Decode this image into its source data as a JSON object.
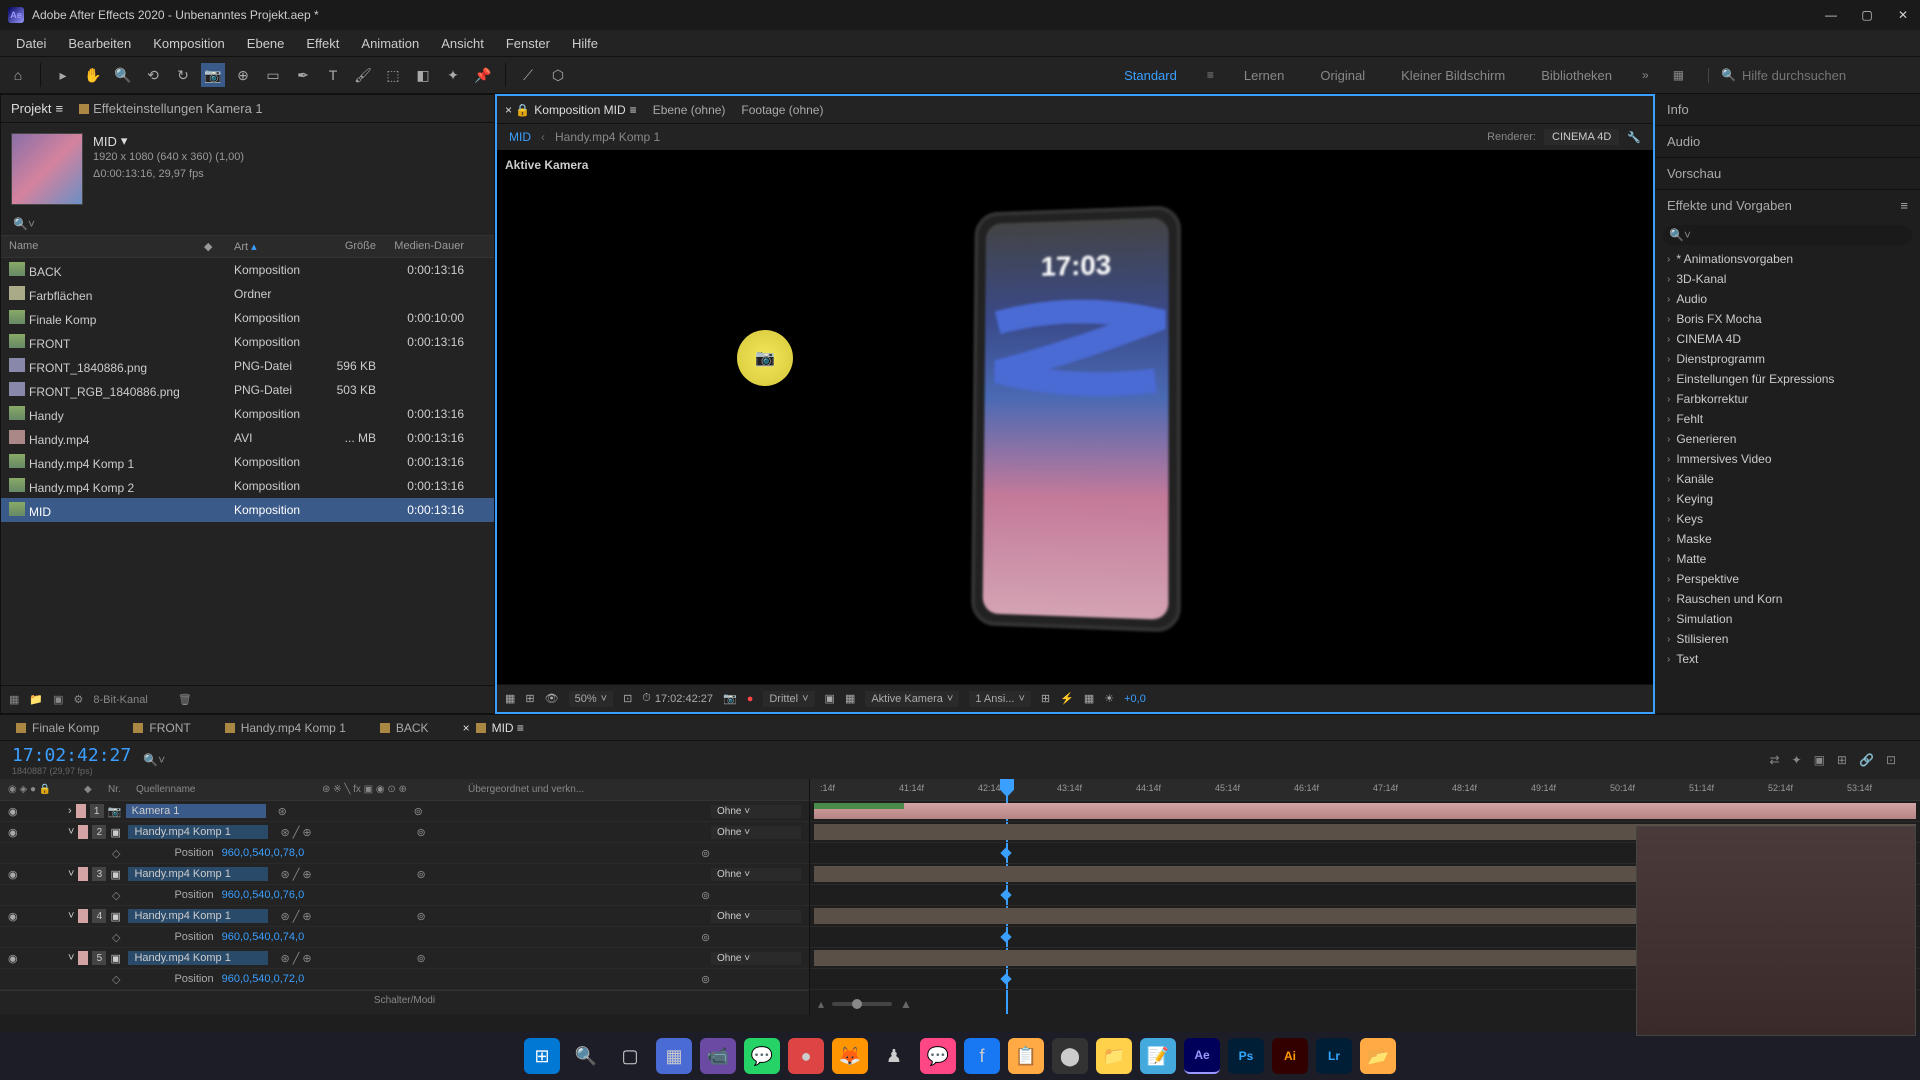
{
  "window": {
    "title": "Adobe After Effects 2020 - Unbenanntes Projekt.aep *"
  },
  "menu": {
    "items": [
      "Datei",
      "Bearbeiten",
      "Komposition",
      "Ebene",
      "Effekt",
      "Animation",
      "Ansicht",
      "Fenster",
      "Hilfe"
    ]
  },
  "workspaces": {
    "items": [
      "Standard",
      "Lernen",
      "Original",
      "Kleiner Bildschirm",
      "Bibliotheken"
    ],
    "active": "Standard",
    "search_placeholder": "Hilfe durchsuchen"
  },
  "project_panel": {
    "tab_project": "Projekt",
    "tab_effects": "Effekteinstellungen  Kamera 1",
    "comp_name": "MID",
    "dimensions": "1920 x 1080 (640 x 360) (1,00)",
    "duration_fps": "Δ0:00:13:16, 29,97 fps",
    "columns": {
      "name": "Name",
      "type": "Art",
      "size": "Größe",
      "duration": "Medien-Dauer"
    },
    "rows": [
      {
        "name": "BACK",
        "type": "Komposition",
        "size": "",
        "dur": "0:00:13:16",
        "icon": "comp"
      },
      {
        "name": "Farbflächen",
        "type": "Ordner",
        "size": "",
        "dur": "",
        "icon": "folder"
      },
      {
        "name": "Finale Komp",
        "type": "Komposition",
        "size": "",
        "dur": "0:00:10:00",
        "icon": "comp"
      },
      {
        "name": "FRONT",
        "type": "Komposition",
        "size": "",
        "dur": "0:00:13:16",
        "icon": "comp"
      },
      {
        "name": "FRONT_1840886.png",
        "type": "PNG-Datei",
        "size": "596 KB",
        "dur": "",
        "icon": "img"
      },
      {
        "name": "FRONT_RGB_1840886.png",
        "type": "PNG-Datei",
        "size": "503 KB",
        "dur": "",
        "icon": "img"
      },
      {
        "name": "Handy",
        "type": "Komposition",
        "size": "",
        "dur": "0:00:13:16",
        "icon": "comp"
      },
      {
        "name": "Handy.mp4",
        "type": "AVI",
        "size": "... MB",
        "dur": "0:00:13:16",
        "icon": "vid"
      },
      {
        "name": "Handy.mp4 Komp 1",
        "type": "Komposition",
        "size": "",
        "dur": "0:00:13:16",
        "icon": "comp"
      },
      {
        "name": "Handy.mp4 Komp 2",
        "type": "Komposition",
        "size": "",
        "dur": "0:00:13:16",
        "icon": "comp"
      },
      {
        "name": "MID",
        "type": "Komposition",
        "size": "",
        "dur": "0:00:13:16",
        "icon": "comp",
        "selected": true
      }
    ],
    "footer_bpc": "8-Bit-Kanal"
  },
  "comp_panel": {
    "tab_comp": "Komposition MID",
    "tab_layer": "Ebene  (ohne)",
    "tab_footage": "Footage  (ohne)",
    "bc_mid": "MID",
    "bc_handy": "Handy.mp4 Komp 1",
    "renderer_label": "Renderer:",
    "renderer_value": "CINEMA 4D",
    "camera_label": "Aktive Kamera",
    "phone_time": "17:03",
    "footer": {
      "zoom": "50%",
      "timecode": "17:02:42:27",
      "resolution": "Drittel",
      "camera": "Aktive Kamera",
      "views": "1 Ansi...",
      "exposure": "+0,0"
    }
  },
  "right": {
    "info": "Info",
    "audio": "Audio",
    "preview": "Vorschau",
    "effects_title": "Effekte und Vorgaben",
    "effects": [
      "* Animationsvorgaben",
      "3D-Kanal",
      "Audio",
      "Boris FX Mocha",
      "CINEMA 4D",
      "Dienstprogramm",
      "Einstellungen für Expressions",
      "Farbkorrektur",
      "Fehlt",
      "Generieren",
      "Immersives Video",
      "Kanäle",
      "Keying",
      "Keys",
      "Maske",
      "Matte",
      "Perspektive",
      "Rauschen und Korn",
      "Simulation",
      "Stilisieren",
      "Text"
    ]
  },
  "timeline": {
    "tabs": [
      "Finale Komp",
      "FRONT",
      "Handy.mp4 Komp 1",
      "BACK",
      "MID"
    ],
    "active_tab": "MID",
    "timecode": "17:02:42:27",
    "timecode_sub": "1840887 (29,97 fps)",
    "col_nr": "Nr.",
    "col_name": "Quellenname",
    "col_parent": "Übergeordnet und verkn...",
    "ruler_ticks": [
      ":14f",
      "41:14f",
      "42:14f",
      "43:14f",
      "44:14f",
      "45:14f",
      "46:14f",
      "47:14f",
      "48:14f",
      "49:14f",
      "50:14f",
      "51:14f",
      "52:14f",
      "53:14f"
    ],
    "layers": [
      {
        "num": "1",
        "name": "Kamera 1",
        "cam": true,
        "parent": "Ohne"
      },
      {
        "num": "2",
        "name": "Handy.mp4 Komp 1",
        "cam": false,
        "parent": "Ohne",
        "prop": "Position",
        "val": "960,0,540,0,78,0"
      },
      {
        "num": "3",
        "name": "Handy.mp4 Komp 1",
        "cam": false,
        "parent": "Ohne",
        "prop": "Position",
        "val": "960,0,540,0,76,0"
      },
      {
        "num": "4",
        "name": "Handy.mp4 Komp 1",
        "cam": false,
        "parent": "Ohne",
        "prop": "Position",
        "val": "960,0,540,0,74,0"
      },
      {
        "num": "5",
        "name": "Handy.mp4 Komp 1",
        "cam": false,
        "parent": "Ohne",
        "prop": "Position",
        "val": "960,0,540,0,72,0"
      }
    ],
    "footer": "Schalter/Modi"
  }
}
